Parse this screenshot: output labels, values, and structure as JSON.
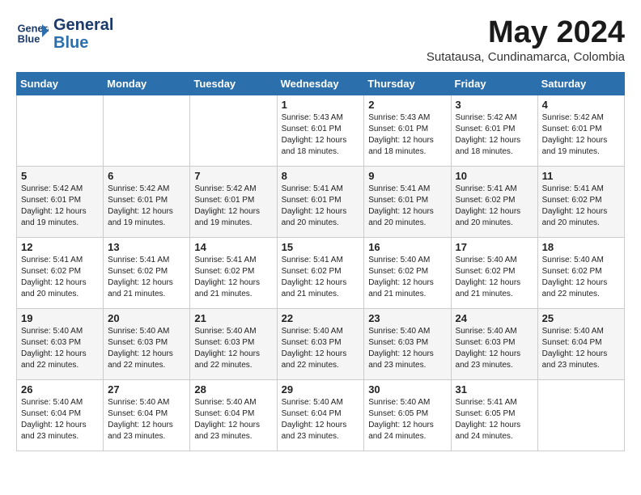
{
  "header": {
    "logo_line1": "General",
    "logo_line2": "Blue",
    "month": "May 2024",
    "location": "Sutatausa, Cundinamarca, Colombia"
  },
  "weekdays": [
    "Sunday",
    "Monday",
    "Tuesday",
    "Wednesday",
    "Thursday",
    "Friday",
    "Saturday"
  ],
  "weeks": [
    [
      {
        "day": "",
        "info": ""
      },
      {
        "day": "",
        "info": ""
      },
      {
        "day": "",
        "info": ""
      },
      {
        "day": "1",
        "info": "Sunrise: 5:43 AM\nSunset: 6:01 PM\nDaylight: 12 hours\nand 18 minutes."
      },
      {
        "day": "2",
        "info": "Sunrise: 5:43 AM\nSunset: 6:01 PM\nDaylight: 12 hours\nand 18 minutes."
      },
      {
        "day": "3",
        "info": "Sunrise: 5:42 AM\nSunset: 6:01 PM\nDaylight: 12 hours\nand 18 minutes."
      },
      {
        "day": "4",
        "info": "Sunrise: 5:42 AM\nSunset: 6:01 PM\nDaylight: 12 hours\nand 19 minutes."
      }
    ],
    [
      {
        "day": "5",
        "info": "Sunrise: 5:42 AM\nSunset: 6:01 PM\nDaylight: 12 hours\nand 19 minutes."
      },
      {
        "day": "6",
        "info": "Sunrise: 5:42 AM\nSunset: 6:01 PM\nDaylight: 12 hours\nand 19 minutes."
      },
      {
        "day": "7",
        "info": "Sunrise: 5:42 AM\nSunset: 6:01 PM\nDaylight: 12 hours\nand 19 minutes."
      },
      {
        "day": "8",
        "info": "Sunrise: 5:41 AM\nSunset: 6:01 PM\nDaylight: 12 hours\nand 20 minutes."
      },
      {
        "day": "9",
        "info": "Sunrise: 5:41 AM\nSunset: 6:01 PM\nDaylight: 12 hours\nand 20 minutes."
      },
      {
        "day": "10",
        "info": "Sunrise: 5:41 AM\nSunset: 6:02 PM\nDaylight: 12 hours\nand 20 minutes."
      },
      {
        "day": "11",
        "info": "Sunrise: 5:41 AM\nSunset: 6:02 PM\nDaylight: 12 hours\nand 20 minutes."
      }
    ],
    [
      {
        "day": "12",
        "info": "Sunrise: 5:41 AM\nSunset: 6:02 PM\nDaylight: 12 hours\nand 20 minutes."
      },
      {
        "day": "13",
        "info": "Sunrise: 5:41 AM\nSunset: 6:02 PM\nDaylight: 12 hours\nand 21 minutes."
      },
      {
        "day": "14",
        "info": "Sunrise: 5:41 AM\nSunset: 6:02 PM\nDaylight: 12 hours\nand 21 minutes."
      },
      {
        "day": "15",
        "info": "Sunrise: 5:41 AM\nSunset: 6:02 PM\nDaylight: 12 hours\nand 21 minutes."
      },
      {
        "day": "16",
        "info": "Sunrise: 5:40 AM\nSunset: 6:02 PM\nDaylight: 12 hours\nand 21 minutes."
      },
      {
        "day": "17",
        "info": "Sunrise: 5:40 AM\nSunset: 6:02 PM\nDaylight: 12 hours\nand 21 minutes."
      },
      {
        "day": "18",
        "info": "Sunrise: 5:40 AM\nSunset: 6:02 PM\nDaylight: 12 hours\nand 22 minutes."
      }
    ],
    [
      {
        "day": "19",
        "info": "Sunrise: 5:40 AM\nSunset: 6:03 PM\nDaylight: 12 hours\nand 22 minutes."
      },
      {
        "day": "20",
        "info": "Sunrise: 5:40 AM\nSunset: 6:03 PM\nDaylight: 12 hours\nand 22 minutes."
      },
      {
        "day": "21",
        "info": "Sunrise: 5:40 AM\nSunset: 6:03 PM\nDaylight: 12 hours\nand 22 minutes."
      },
      {
        "day": "22",
        "info": "Sunrise: 5:40 AM\nSunset: 6:03 PM\nDaylight: 12 hours\nand 22 minutes."
      },
      {
        "day": "23",
        "info": "Sunrise: 5:40 AM\nSunset: 6:03 PM\nDaylight: 12 hours\nand 23 minutes."
      },
      {
        "day": "24",
        "info": "Sunrise: 5:40 AM\nSunset: 6:03 PM\nDaylight: 12 hours\nand 23 minutes."
      },
      {
        "day": "25",
        "info": "Sunrise: 5:40 AM\nSunset: 6:04 PM\nDaylight: 12 hours\nand 23 minutes."
      }
    ],
    [
      {
        "day": "26",
        "info": "Sunrise: 5:40 AM\nSunset: 6:04 PM\nDaylight: 12 hours\nand 23 minutes."
      },
      {
        "day": "27",
        "info": "Sunrise: 5:40 AM\nSunset: 6:04 PM\nDaylight: 12 hours\nand 23 minutes."
      },
      {
        "day": "28",
        "info": "Sunrise: 5:40 AM\nSunset: 6:04 PM\nDaylight: 12 hours\nand 23 minutes."
      },
      {
        "day": "29",
        "info": "Sunrise: 5:40 AM\nSunset: 6:04 PM\nDaylight: 12 hours\nand 23 minutes."
      },
      {
        "day": "30",
        "info": "Sunrise: 5:40 AM\nSunset: 6:05 PM\nDaylight: 12 hours\nand 24 minutes."
      },
      {
        "day": "31",
        "info": "Sunrise: 5:41 AM\nSunset: 6:05 PM\nDaylight: 12 hours\nand 24 minutes."
      },
      {
        "day": "",
        "info": ""
      }
    ]
  ]
}
